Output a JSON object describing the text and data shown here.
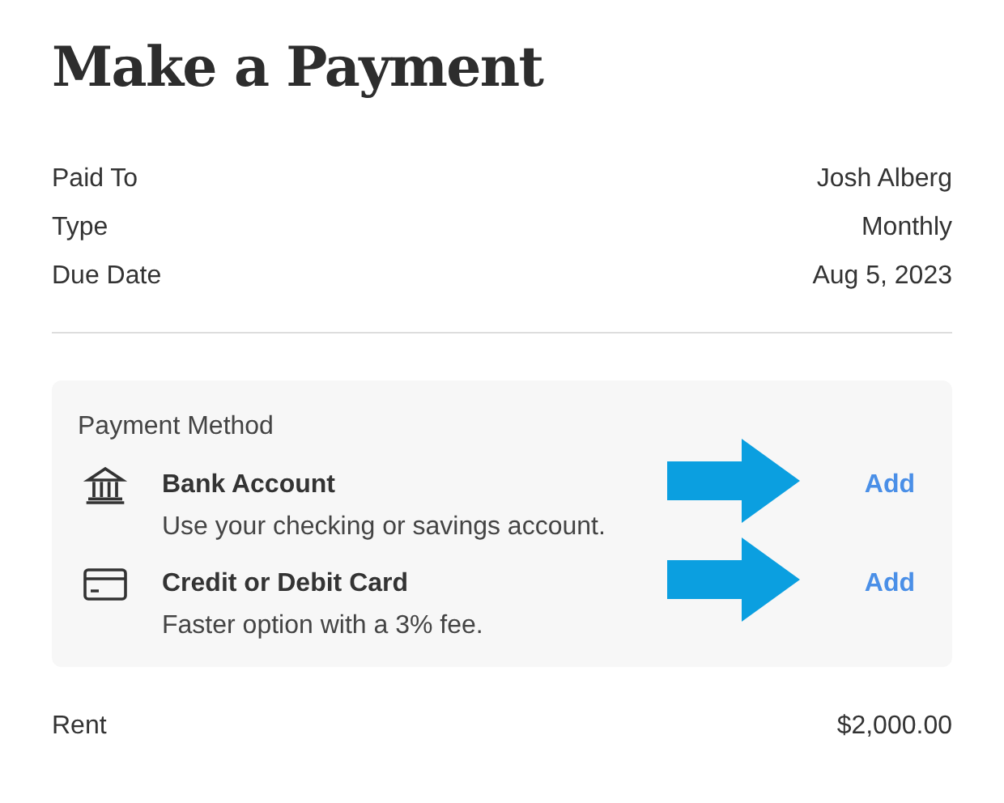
{
  "title": "Make a Payment",
  "details": [
    {
      "label": "Paid To",
      "value": "Josh Alberg"
    },
    {
      "label": "Type",
      "value": "Monthly"
    },
    {
      "label": "Due Date",
      "value": "Aug 5, 2023"
    }
  ],
  "payment_method": {
    "heading": "Payment Method",
    "methods": [
      {
        "kind": "bank",
        "name": "Bank Account",
        "description": "Use your checking or savings account.",
        "action": "Add",
        "annotated": true
      },
      {
        "kind": "card",
        "name": "Credit or Debit Card",
        "description": "Faster option with a 3% fee.",
        "action": "Add",
        "annotated": true
      }
    ]
  },
  "summary": [
    {
      "label": "Rent",
      "value": "$2,000.00"
    }
  ]
}
